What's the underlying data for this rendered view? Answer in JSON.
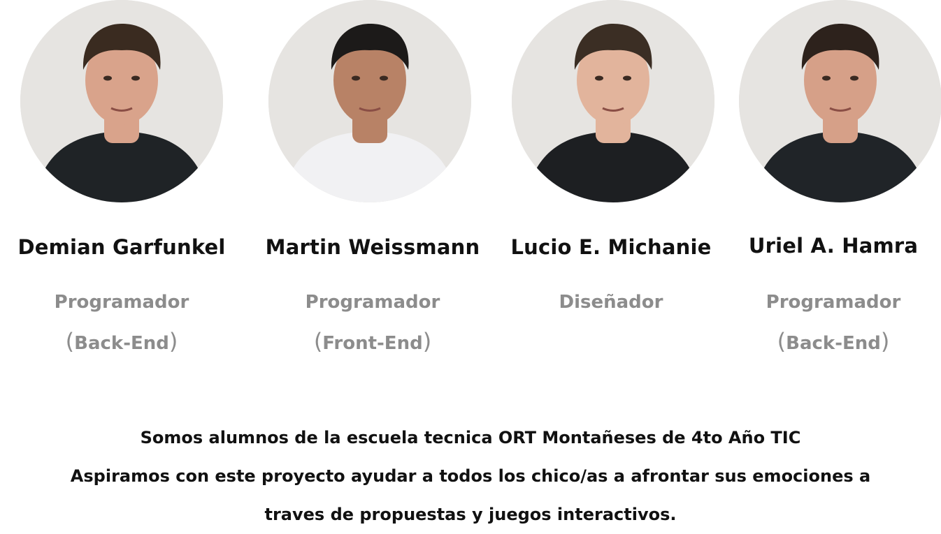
{
  "members": [
    {
      "name": "Demian Garfunkel",
      "role": "Programador",
      "specialty": "Back-End",
      "photo_icon": "portrait-photo",
      "shirt": "#1f2326",
      "hair": "#3a2b20",
      "skin": "#d9a38b"
    },
    {
      "name": "Martin Weissmann",
      "role": "Programador",
      "specialty": "Front-End",
      "photo_icon": "portrait-photo",
      "shirt": "#f1f1f3",
      "hair": "#1c1a19",
      "skin": "#b88266"
    },
    {
      "name": "Lucio E. Michanie",
      "role": "Diseñador",
      "specialty": "",
      "photo_icon": "portrait-photo",
      "shirt": "#1d1f22",
      "hair": "#3b2e24",
      "skin": "#e2b49c"
    },
    {
      "name": "Uriel A. Hamra",
      "role": "Programador",
      "specialty": "Back-End",
      "photo_icon": "portrait-photo",
      "shirt": "#202428",
      "hair": "#2d221c",
      "skin": "#d6a088"
    }
  ],
  "about": {
    "line1": "Somos alumnos de la escuela tecnica ORT Montañeses de 4to Año TIC",
    "line2": "Aspiramos con este proyecto ayudar a todos los chico/as a afrontar sus emociones a",
    "line3": "traves de propuestas y juegos interactivos."
  },
  "colors": {
    "name_text": "#111111",
    "role_text": "#8c8c8c",
    "photo_background": "#e6e4e1"
  }
}
